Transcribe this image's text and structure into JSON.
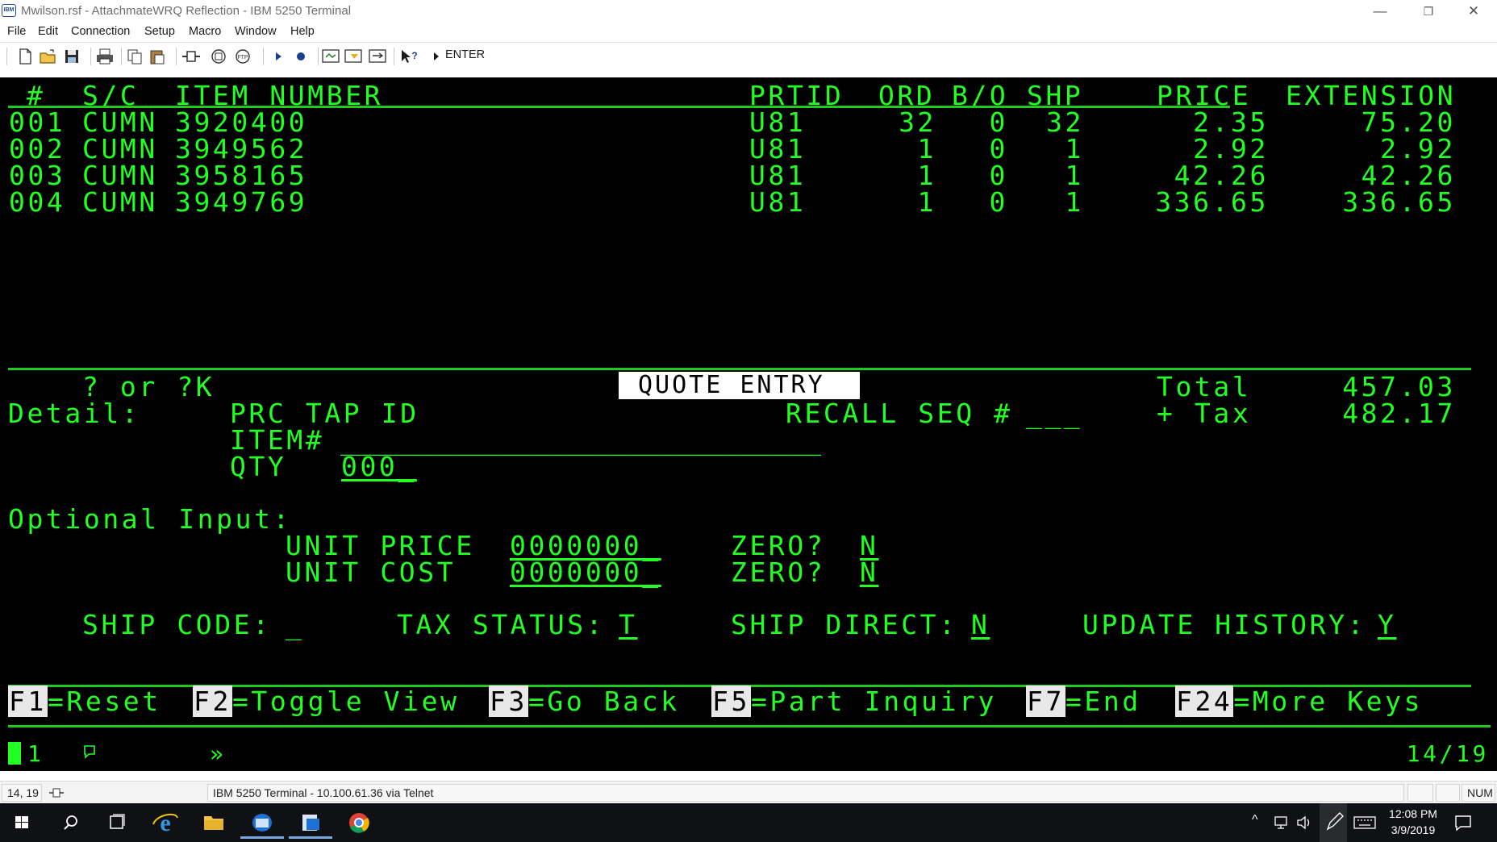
{
  "window": {
    "app_icon_text": "IBM",
    "title": "Mwilson.rsf - AttachmateWRQ Reflection - IBM 5250 Terminal",
    "minimize": "—",
    "restore": "❐",
    "close": "✕"
  },
  "menu": [
    "File",
    "Edit",
    "Connection",
    "Setup",
    "Macro",
    "Window",
    "Help"
  ],
  "toolbar": {
    "enter_label": "ENTER"
  },
  "terminal": {
    "header": {
      "num": "#",
      "sc": "S/C",
      "item_number": "ITEM NUMBER",
      "prtid": "PRTID",
      "ord": "ORD",
      "bo": "B/O",
      "shp": "SHP",
      "price": "PRICE",
      "extension": "EXTENSION"
    },
    "rows": [
      {
        "num": "001",
        "sc": "CUMN",
        "item": "3920400",
        "prtid": "U81",
        "ord": "32",
        "bo": "0",
        "shp": "32",
        "price": "2.35",
        "extension": "75.20"
      },
      {
        "num": "002",
        "sc": "CUMN",
        "item": "3949562",
        "prtid": "U81",
        "ord": "1",
        "bo": "0",
        "shp": "1",
        "price": "2.92",
        "extension": "2.92"
      },
      {
        "num": "003",
        "sc": "CUMN",
        "item": "3958165",
        "prtid": "U81",
        "ord": "1",
        "bo": "0",
        "shp": "1",
        "price": "42.26",
        "extension": "42.26"
      },
      {
        "num": "004",
        "sc": "CUMN",
        "item": "3949769",
        "prtid": "U81",
        "ord": "1",
        "bo": "0",
        "shp": "1",
        "price": "336.65",
        "extension": "336.65"
      }
    ],
    "help_hint": "? or ?K",
    "screen_title": "QUOTE ENTRY",
    "total_label": "Total",
    "total_value": "457.03",
    "tax_label": "+ Tax",
    "tax_value": "482.17",
    "detail_label": "Detail:",
    "prc_tap_id_label": "PRC TAP ID",
    "recall_seq_label": "RECALL SEQ #",
    "recall_seq_value": "___",
    "item_label": "ITEM#",
    "item_value": "______________________________",
    "qty_label": "QTY",
    "qty_value": "000_",
    "optional_label": "Optional Input:",
    "unit_price_label": "UNIT PRICE",
    "unit_price_value": "0000000_",
    "unit_cost_label": "UNIT COST",
    "unit_cost_value": "0000000_",
    "zero_label": "ZERO?",
    "zero_price_value": "N",
    "zero_cost_value": "N",
    "ship_code_label": "SHIP CODE:",
    "ship_code_value": "_",
    "tax_status_label": "TAX STATUS:",
    "tax_status_value": "T",
    "ship_direct_label": "SHIP DIRECT:",
    "ship_direct_value": "N",
    "update_history_label": "UPDATE HISTORY:",
    "update_history_value": "Y",
    "fkeys": [
      {
        "key": "F1",
        "label": "=Reset"
      },
      {
        "key": "F2",
        "label": "=Toggle View"
      },
      {
        "key": "F3",
        "label": "=Go Back"
      },
      {
        "key": "F5",
        "label": "=Part Inquiry"
      },
      {
        "key": "F7",
        "label": "=End"
      },
      {
        "key": "F24",
        "label": "=More Keys"
      }
    ],
    "oia_session": "1",
    "oia_input_symbol": "»",
    "cursor_position": "14/19"
  },
  "status_bar": {
    "cursor_pos": "14, 19",
    "connection": "IBM 5250 Terminal - 10.100.61.36 via Telnet",
    "num_lock": "NUM"
  },
  "taskbar": {
    "time": "12:08 PM",
    "date": "3/9/2019"
  },
  "colors": {
    "terminal_bg": "#000000",
    "terminal_fg": "#22ff22",
    "taskbar_bg": "#101114"
  }
}
